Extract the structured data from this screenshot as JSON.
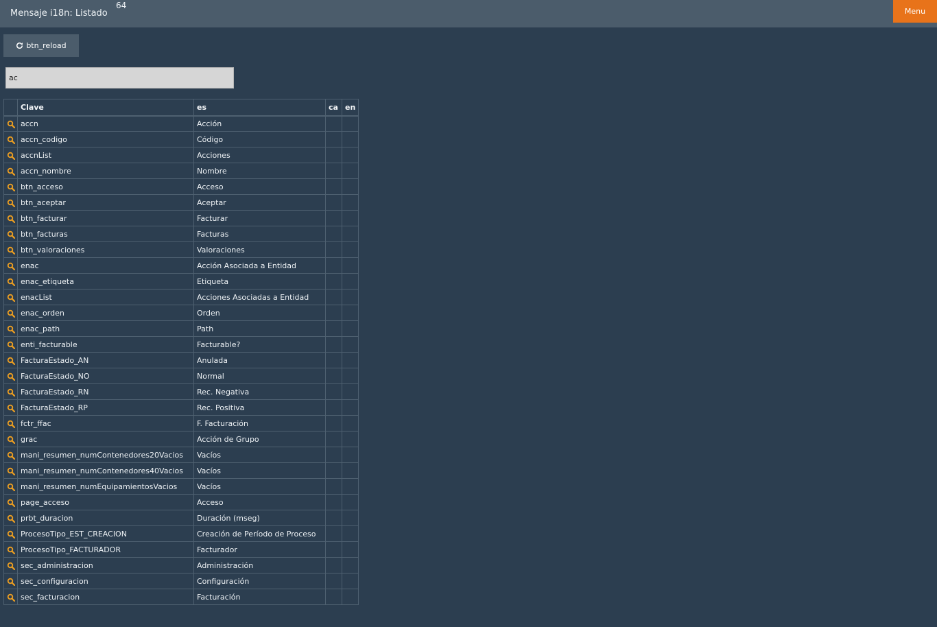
{
  "header": {
    "title": "Mensaje i18n: Listado",
    "count": "64",
    "menu_label": "Menu"
  },
  "toolbar": {
    "reload_label": "btn_reload",
    "reload_icon": "refresh-icon"
  },
  "search": {
    "value": "ac"
  },
  "colors": {
    "background": "#2c3e50",
    "topbar": "#4b5c6b",
    "accent": "#e8731a",
    "icon": "#f0a020"
  },
  "table": {
    "columns": [
      "Clave",
      "es",
      "ca",
      "en"
    ],
    "row_icon": "magnifier-icon",
    "rows": [
      {
        "clave": "accn",
        "es": "Acción"
      },
      {
        "clave": "accn_codigo",
        "es": "Código"
      },
      {
        "clave": "accnList",
        "es": "Acciones"
      },
      {
        "clave": "accn_nombre",
        "es": "Nombre"
      },
      {
        "clave": "btn_acceso",
        "es": "Acceso"
      },
      {
        "clave": "btn_aceptar",
        "es": "Aceptar"
      },
      {
        "clave": "btn_facturar",
        "es": "Facturar"
      },
      {
        "clave": "btn_facturas",
        "es": "Facturas"
      },
      {
        "clave": "btn_valoraciones",
        "es": "Valoraciones"
      },
      {
        "clave": "enac",
        "es": "Acción Asociada a Entidad"
      },
      {
        "clave": "enac_etiqueta",
        "es": "Etiqueta"
      },
      {
        "clave": "enacList",
        "es": "Acciones Asociadas a Entidad"
      },
      {
        "clave": "enac_orden",
        "es": "Orden"
      },
      {
        "clave": "enac_path",
        "es": "Path"
      },
      {
        "clave": "enti_facturable",
        "es": "Facturable?"
      },
      {
        "clave": "FacturaEstado_AN",
        "es": "Anulada"
      },
      {
        "clave": "FacturaEstado_NO",
        "es": "Normal"
      },
      {
        "clave": "FacturaEstado_RN",
        "es": "Rec. Negativa"
      },
      {
        "clave": "FacturaEstado_RP",
        "es": "Rec. Positiva"
      },
      {
        "clave": "fctr_ffac",
        "es": "F. Facturación"
      },
      {
        "clave": "grac",
        "es": "Acción de Grupo"
      },
      {
        "clave": "mani_resumen_numContenedores20Vacios",
        "es": "Vacíos"
      },
      {
        "clave": "mani_resumen_numContenedores40Vacios",
        "es": "Vacíos"
      },
      {
        "clave": "mani_resumen_numEquipamientosVacios",
        "es": "Vacíos"
      },
      {
        "clave": "page_acceso",
        "es": "Acceso"
      },
      {
        "clave": "prbt_duracion",
        "es": "Duración (mseg)"
      },
      {
        "clave": "ProcesoTipo_EST_CREACION",
        "es": "Creación de Período de Proceso"
      },
      {
        "clave": "ProcesoTipo_FACTURADOR",
        "es": "Facturador"
      },
      {
        "clave": "sec_administracion",
        "es": "Administración"
      },
      {
        "clave": "sec_configuracion",
        "es": "Configuración"
      },
      {
        "clave": "sec_facturacion",
        "es": "Facturación"
      }
    ]
  }
}
